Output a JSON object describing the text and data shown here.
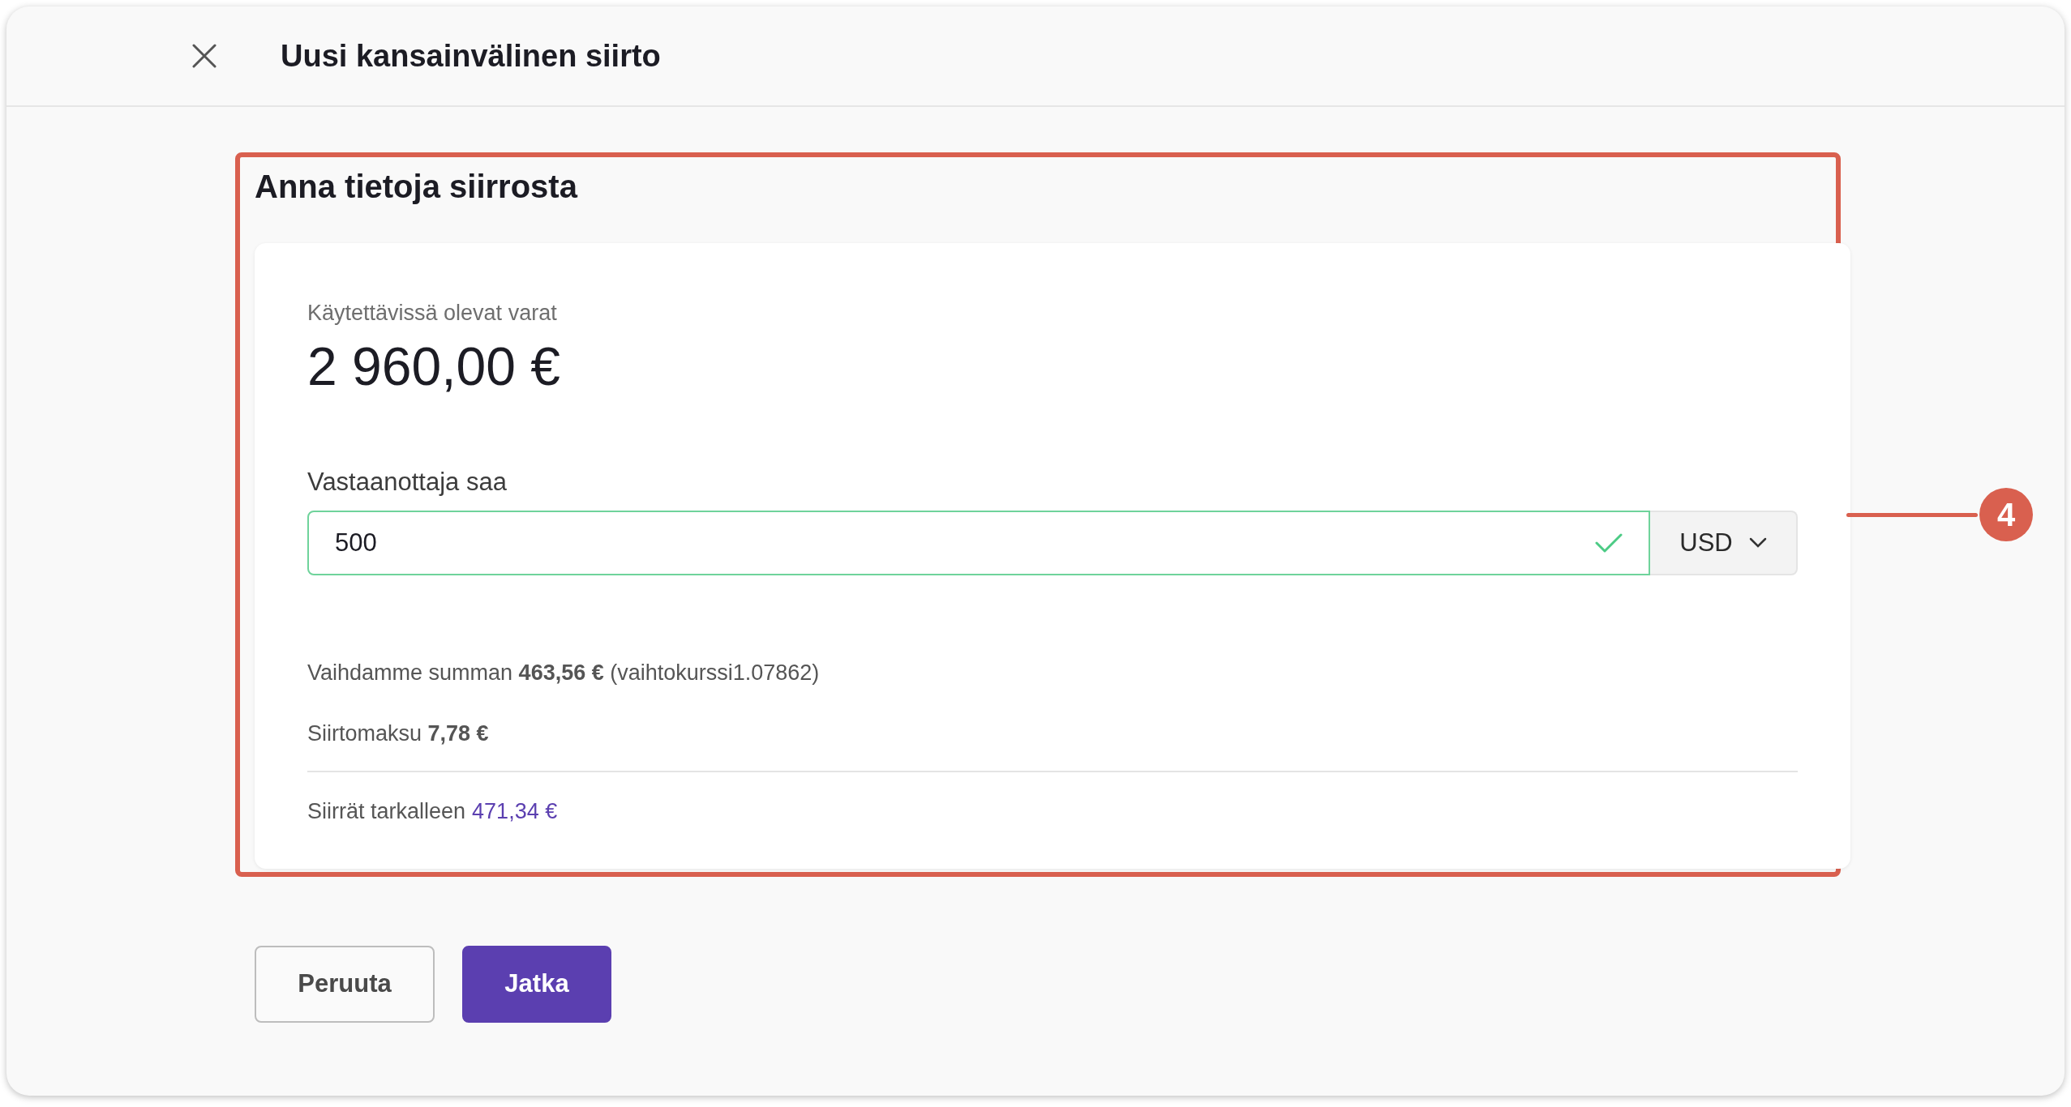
{
  "header": {
    "title": "Uusi kansainvälinen siirto"
  },
  "section": {
    "heading": "Anna tietoja siirrosta",
    "annotation": "4"
  },
  "balance": {
    "label": "Käytettävissä olevat varat",
    "amount": "2 960,00 €"
  },
  "amount_field": {
    "label": "Vastaanottaja saa",
    "value": "500",
    "valid": true,
    "currency": "USD"
  },
  "summary": [
    {
      "text": "Vaihdamme summan **463,56 €** (vaihtokurssi1.07862)"
    },
    {
      "text": "Siirtomaksu **7,78 €**"
    }
  ],
  "total": {
    "label": "Siirrät tarkalleen",
    "value": "471,34 €"
  },
  "buttons": [
    {
      "label": "Peruuta",
      "kind": "secondary"
    },
    {
      "label": "Jatka",
      "kind": "primary"
    }
  ]
}
